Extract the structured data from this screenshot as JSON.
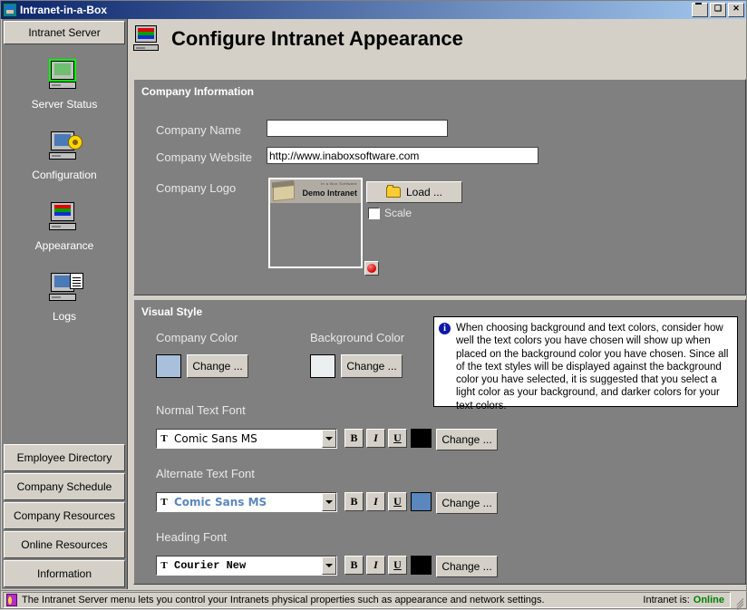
{
  "window": {
    "title": "Intranet-in-a-Box",
    "minimize_label": "_",
    "maximize_label": "□",
    "close_label": "✕"
  },
  "sidebar": {
    "tab_label": "Intranet Server",
    "nav_items": [
      {
        "label": "Server Status",
        "icon": "server-status-icon"
      },
      {
        "label": "Configuration",
        "icon": "configuration-icon"
      },
      {
        "label": "Appearance",
        "icon": "appearance-icon"
      },
      {
        "label": "Logs",
        "icon": "logs-icon"
      }
    ],
    "bottom_buttons": [
      {
        "label": "Employee Directory"
      },
      {
        "label": "Company Schedule"
      },
      {
        "label": "Company Resources"
      },
      {
        "label": "Online Resources"
      },
      {
        "label": "Information"
      }
    ]
  },
  "header": {
    "title": "Configure Intranet Appearance",
    "icon": "monitor-rgb-icon"
  },
  "company_information": {
    "group_title": "Company Information",
    "company_name": {
      "label": "Company Name",
      "value": "",
      "placeholder": ""
    },
    "company_website": {
      "label": "Company Website",
      "value": "http://www.inaboxsoftware.com",
      "placeholder": ""
    },
    "company_logo": {
      "label": "Company Logo",
      "preview_caption_small": "In a Box Software",
      "preview_caption": "Demo Intranet",
      "load_button": "Load ...",
      "scale_checkbox_label": "Scale",
      "scale_checked": false,
      "clear_button_name": "clear-logo-button"
    }
  },
  "visual_style": {
    "group_title": "Visual Style",
    "company_color": {
      "label": "Company Color",
      "swatch_hex": "#a8c0dc",
      "change_button": "Change ..."
    },
    "background_color": {
      "label": "Background Color",
      "swatch_hex": "#eceff0",
      "change_button": "Change ..."
    },
    "info_tip": {
      "icon": "info-icon",
      "text": "When choosing background and text colors, consider how well the text colors you have chosen will show up when placed on the background color you have chosen.  Since all of the text styles will be displayed against the background color you have selected, it is suggested that you select a light color as your background, and darker colors for your text colors."
    },
    "fonts": [
      {
        "label": "Normal Text Font",
        "font_name": "Comic Sans MS",
        "bold_label": "B",
        "italic_label": "I",
        "underline_label": "U",
        "color_hex": "#000000",
        "change_button": "Change ..."
      },
      {
        "label": "Alternate Text Font",
        "font_name": "Comic Sans MS",
        "bold_label": "B",
        "italic_label": "I",
        "underline_label": "U",
        "color_hex": "#5a87bd",
        "change_button": "Change ..."
      },
      {
        "label": "Heading Font",
        "font_name": "Courier New",
        "bold_label": "B",
        "italic_label": "I",
        "underline_label": "U",
        "color_hex": "#000000",
        "change_button": "Change ..."
      }
    ]
  },
  "status_bar": {
    "message": "The Intranet Server menu lets you control your Intranets physical properties such as appearance and network settings.",
    "right_label": "Intranet is:",
    "right_value": "Online",
    "right_value_hex": "#008000"
  }
}
